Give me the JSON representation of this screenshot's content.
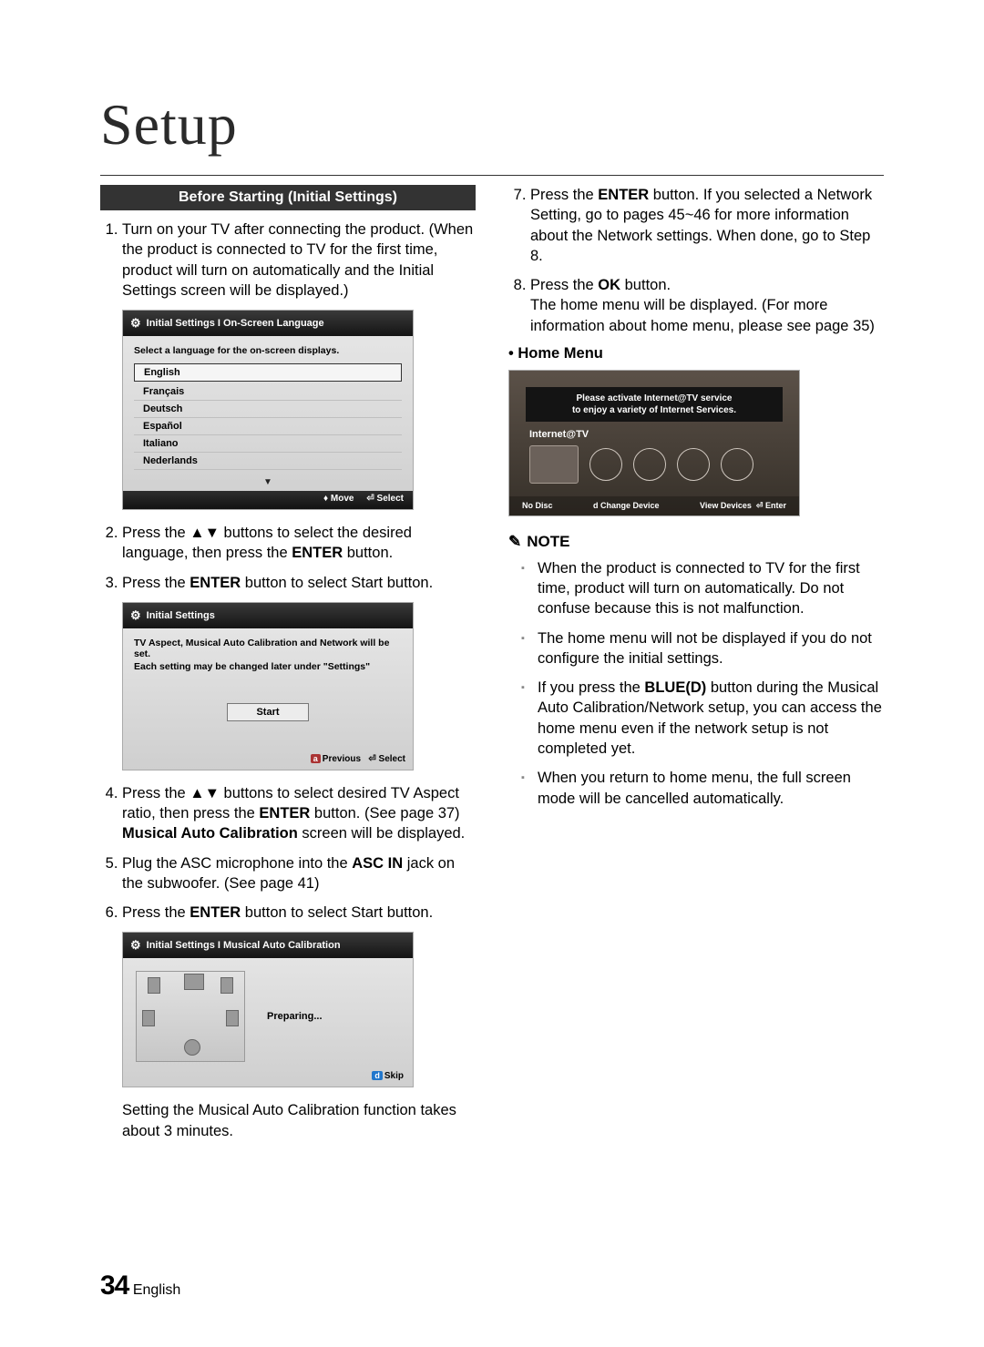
{
  "page": {
    "title": "Setup",
    "number": "34",
    "language": "English"
  },
  "section_header": "Before Starting (Initial Settings)",
  "steps_left": {
    "s1": "Turn on your TV after connecting the product. (When the product is connected to TV for the first time, product will turn on automatically and the Initial Settings screen will be displayed.)",
    "s2_a": "Press the ",
    "s2_b": " buttons to select the desired language, then press the ",
    "s2_enter": "ENTER",
    "s2_c": " button.",
    "s3_a": "Press the ",
    "s3_enter": "ENTER",
    "s3_b": " button to select Start button.",
    "s4_a": "Press the ",
    "s4_b": " buttons to select desired TV Aspect ratio, then press the ",
    "s4_enter": "ENTER",
    "s4_c": " button. (See page 37)",
    "s4_note_a": "Musical Auto Calibration",
    "s4_note_b": " screen will be displayed.",
    "s5_a": "Plug the ASC microphone into the ",
    "s5_asc": "ASC IN",
    "s5_b": " jack on the subwoofer. (See page 41)",
    "s6_a": "Press the ",
    "s6_enter": "ENTER",
    "s6_b": " button to select Start button.",
    "after6": "Setting the Musical Auto Calibration function takes about 3 minutes."
  },
  "steps_right": {
    "s7_a": "Press the ",
    "s7_enter": "ENTER",
    "s7_b": " button. If you selected a Network Setting, go to pages 45~46 for more information about the Network settings. When done, go to Step 8.",
    "s8_a": "Press the ",
    "s8_ok": "OK",
    "s8_b": " button.\nThe home menu will be displayed. (For more information about home menu, please see page 35)"
  },
  "home_menu_label": "• Home Menu",
  "screenshot1": {
    "title": "Initial Settings I On-Screen Language",
    "prompt": "Select a language for the on-screen displays.",
    "languages": [
      "English",
      "Français",
      "Deutsch",
      "Español",
      "Italiano",
      "Nederlands"
    ],
    "footer_move": "Move",
    "footer_select": "Select"
  },
  "screenshot2": {
    "title": "Initial Settings",
    "line1": "TV Aspect, Musical Auto Calibration and Network will be set.",
    "line2": "Each setting may be changed later under \"Settings\"",
    "start": "Start",
    "prev": "Previous",
    "select": "Select"
  },
  "screenshot3": {
    "title": "Initial Settings I Musical Auto Calibration",
    "preparing": "Preparing...",
    "skip": "Skip"
  },
  "home_screenshot": {
    "banner_l1": "Please activate Internet@TV service",
    "banner_l2": "to enjoy a variety of Internet Services.",
    "label": "Internet@TV",
    "footer_disc": "No Disc",
    "footer_change": "Change Device",
    "footer_view": "View Devices",
    "footer_enter": "Enter"
  },
  "note": {
    "header": "NOTE",
    "n1": "When the product is connected to TV for the first time, product will turn on automatically. Do not confuse because this is not malfunction.",
    "n2": "The home menu will not be displayed if you do not configure the initial settings.",
    "n3_a": "If you press the ",
    "n3_blue": "BLUE(D)",
    "n3_b": " button during the Musical Auto Calibration/Network setup, you can access the home menu even if the network setup is not completed yet.",
    "n4": "When you return to home menu, the full screen mode will be cancelled automatically."
  }
}
